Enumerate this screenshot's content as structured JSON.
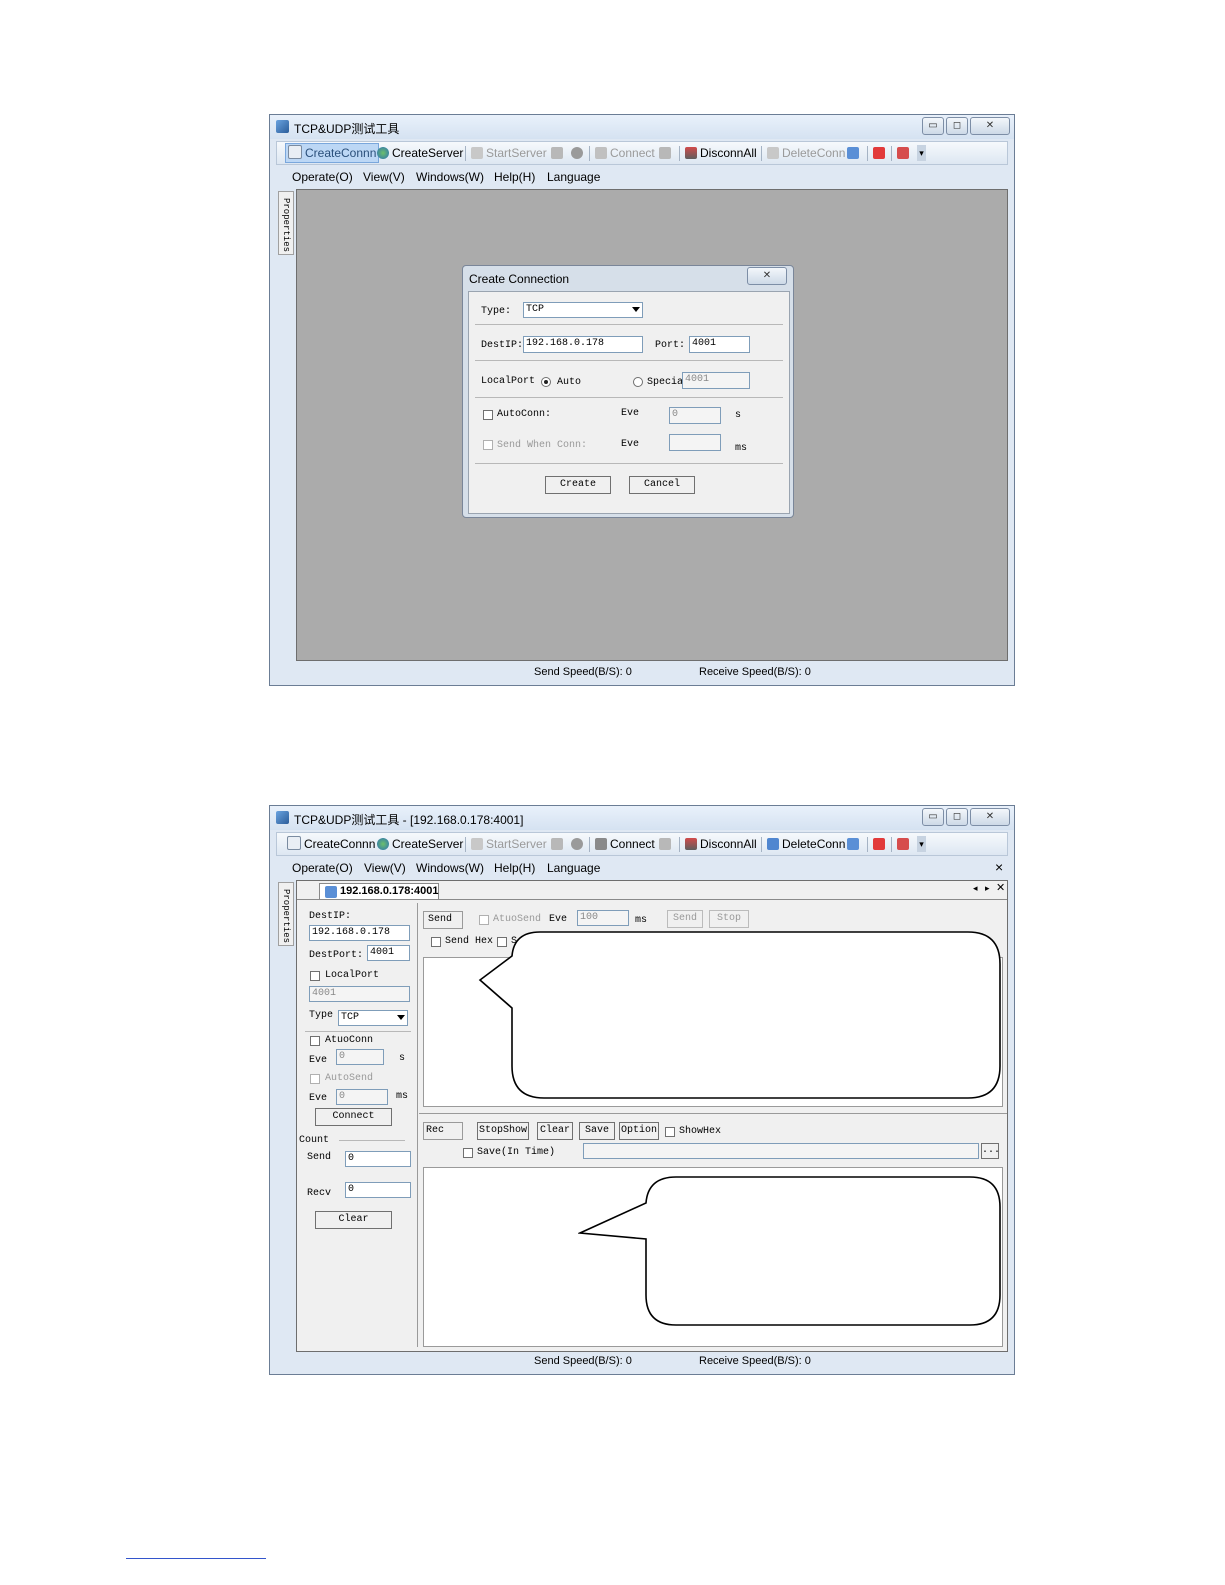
{
  "window1": {
    "title": "TCP&UDP测试工具",
    "toolbar": {
      "create_conn": "CreateConnn",
      "create_server": "CreateServer",
      "start_server": "StartServer",
      "connect": "Connect",
      "disconn_all": "DisconnAll",
      "delete_conn": "DeleteConn"
    },
    "menu": [
      "Operate(O)",
      "View(V)",
      "Windows(W)",
      "Help(H)",
      "Language"
    ],
    "side_tab": "Properties",
    "dialog": {
      "title": "Create Connection",
      "type_label": "Type:",
      "type_value": "TCP",
      "destip_label": "DestIP:",
      "destip_value": "192.168.0.178",
      "port_label": "Port:",
      "port_value": "4001",
      "localport_label": "LocalPort",
      "auto_label": "Auto",
      "special_label": "Specia",
      "special_value": "4001",
      "autoconn_label": "AutoConn:",
      "eve_label": "Eve",
      "eve_value": "0",
      "unit_s": "s",
      "send_when_conn_label": "Send When Conn:",
      "eve2_label": "Eve",
      "unit_ms": "ms",
      "create_button": "Create",
      "cancel_button": "Cancel"
    },
    "status": {
      "send_speed": "Send Speed(B/S): 0",
      "receive_speed": "Receive Speed(B/S): 0"
    }
  },
  "window2": {
    "title": "TCP&UDP测试工具 - [192.168.0.178:4001]",
    "toolbar": {
      "create_conn": "CreateConnn",
      "create_server": "CreateServer",
      "start_server": "StartServer",
      "connect": "Connect",
      "disconn_all": "DisconnAll",
      "delete_conn": "DeleteConn"
    },
    "menu": [
      "Operate(O)",
      "View(V)",
      "Windows(W)",
      "Help(H)",
      "Language"
    ],
    "close_glyph": "×",
    "side_tab": "Properties",
    "doc_tab": "192.168.0.178:4001",
    "left_panel": {
      "destip_label": "DestIP:",
      "destip_value": "192.168.0.178",
      "destport_label": "DestPort:",
      "destport_value": "4001",
      "localport_label": "LocalPort",
      "localport_value": "4001",
      "type_label": "Type",
      "type_value": "TCP",
      "atuoconn_label": "AtuoConn",
      "eve_label": "Eve",
      "eve_value": "0",
      "unit_s": "s",
      "autosend_label": "AutoSend",
      "eve2_label": "Eve",
      "eve2_value": "0",
      "unit_ms": "ms",
      "connect_button": "Connect",
      "count_label": "Count",
      "send_label": "Send",
      "send_value": "0",
      "recv_label": "Recv",
      "recv_value": "0",
      "clear_button": "Clear"
    },
    "send_panel": {
      "send_label": "Send",
      "atuosend_label": "AtuoSend",
      "eve_label": "Eve",
      "eve_value": "100",
      "unit_ms": "ms",
      "send_button": "Send",
      "stop_button": "Stop",
      "send_hex_label": "Send Hex",
      "s_label": "S"
    },
    "recv_panel": {
      "rec_label": "Rec",
      "stopshow_button": "StopShow",
      "clear_button": "Clear",
      "save_button": "Save",
      "option_button": "Option",
      "showhex_label": "ShowHex",
      "save_in_time_label": "Save(In Time)",
      "browse_button": "..."
    },
    "status": {
      "send_speed": "Send Speed(B/S): 0",
      "receive_speed": "Receive Speed(B/S): 0"
    }
  }
}
